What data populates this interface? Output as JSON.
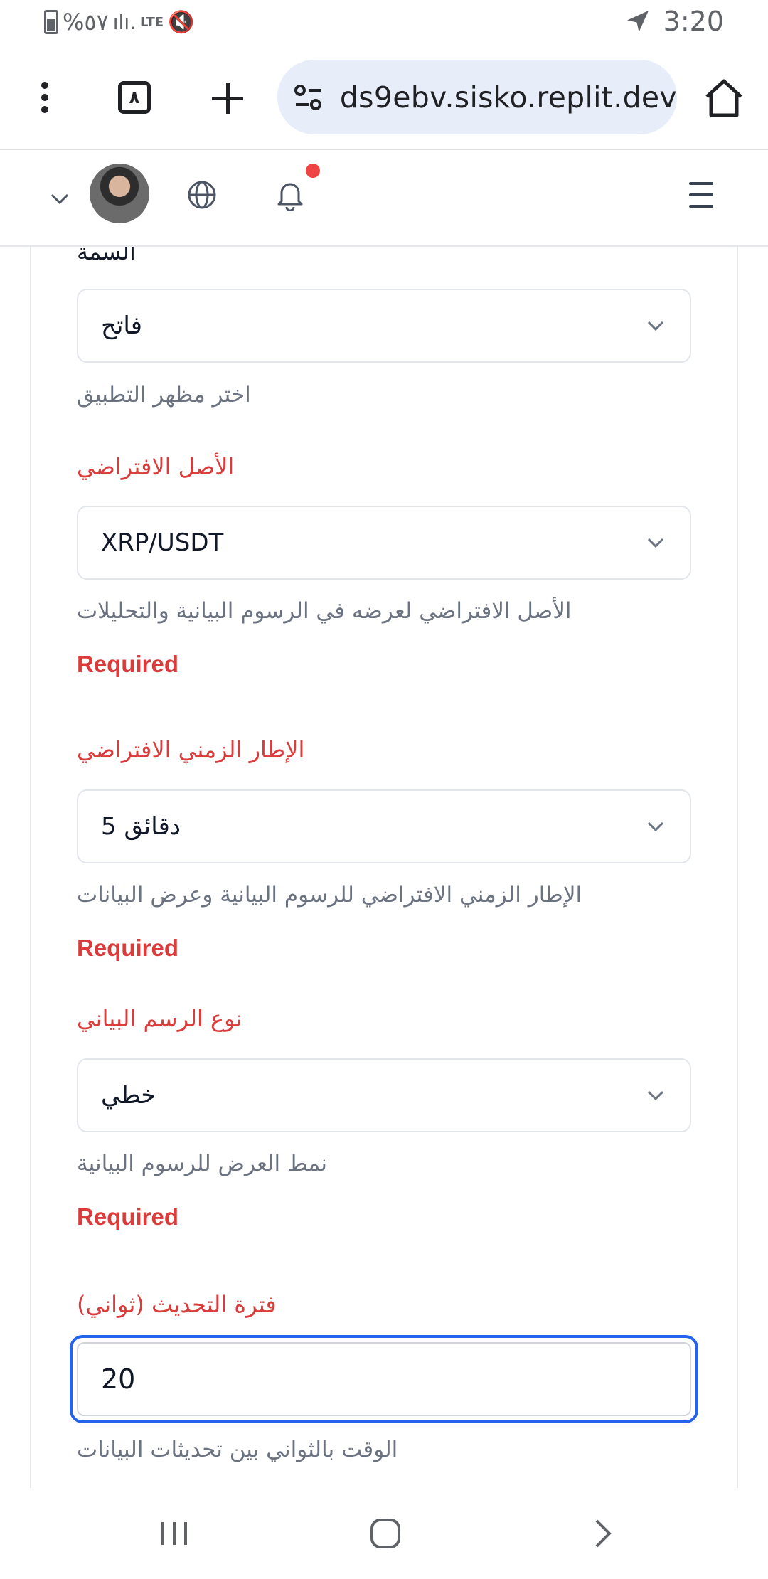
{
  "status_bar": {
    "battery_text": "%٥٧",
    "signal_text": "LTE",
    "time": "3:20"
  },
  "browser": {
    "tab_count": "٨",
    "url": "ds9ebv.sisko.replit.dev"
  },
  "form": {
    "theme": {
      "label": "السمة",
      "value": "فاتح",
      "helper": "اختر مظهر التطبيق"
    },
    "default_asset": {
      "label": "الأصل الافتراضي",
      "value": "XRP/USDT",
      "helper": "الأصل الافتراضي لعرضه في الرسوم البيانية والتحليلات",
      "error": "Required"
    },
    "default_timeframe": {
      "label": "الإطار الزمني الافتراضي",
      "value": "5 دقائق",
      "helper": "الإطار الزمني الافتراضي للرسوم البيانية وعرض البيانات",
      "error": "Required"
    },
    "chart_type": {
      "label": "نوع الرسم البياني",
      "value": "خطي",
      "helper": "نمط العرض للرسوم البيانية",
      "error": "Required"
    },
    "refresh_interval": {
      "label": "فترة التحديث (ثواني)",
      "value": "20",
      "helper": "الوقت بالثواني بين تحديثات البيانات"
    }
  },
  "colors": {
    "error": "#dc3b3b",
    "focus": "#2563eb",
    "url_bar": "#e8eef9"
  }
}
